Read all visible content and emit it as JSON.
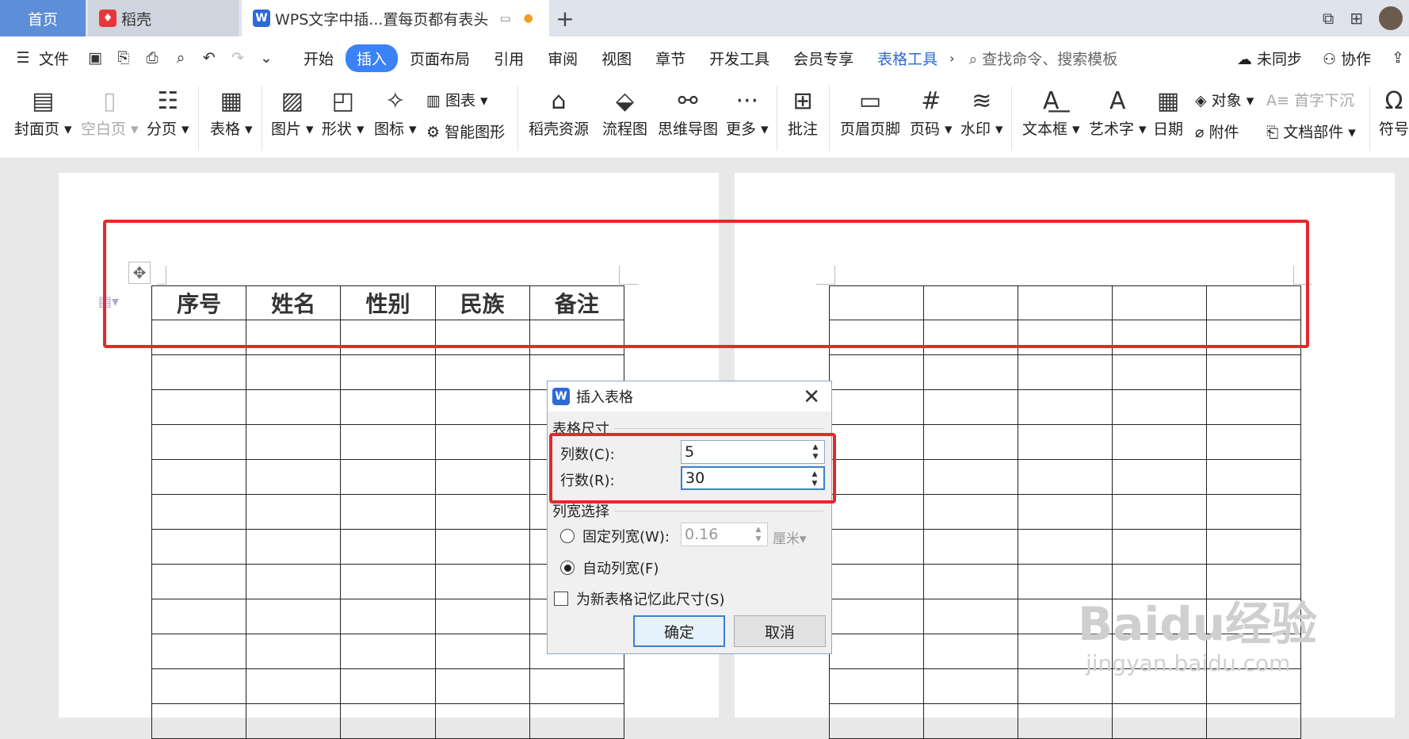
{
  "tabs": [
    {
      "label": "首页"
    },
    {
      "label": "稻壳",
      "icon": "W"
    },
    {
      "label": "WPS文字中插...置每页都有表头",
      "icon": "W"
    }
  ],
  "menu": {
    "file": "文件",
    "items": [
      "开始",
      "插入",
      "页面布局",
      "引用",
      "审阅",
      "视图",
      "章节",
      "开发工具",
      "会员专享",
      "表格工具"
    ],
    "active": "插入",
    "search_placeholder": "查找命令、搜索模板",
    "sync": "未同步",
    "collab": "协作"
  },
  "ribbon": {
    "cover": "封面页",
    "blank": "空白页",
    "pagebreak": "分页",
    "table": "表格",
    "image": "图片",
    "shape": "形状",
    "icon": "图标",
    "chart": "图表",
    "smart": "智能图形",
    "docer": "稻壳资源",
    "flow": "流程图",
    "mind": "思维导图",
    "more": "更多",
    "comment": "批注",
    "headerfooter": "页眉页脚",
    "pagenum": "页码",
    "watermark": "水印",
    "textbox": "文本框",
    "wordart": "艺术字",
    "date": "日期",
    "object": "对象",
    "attach": "附件",
    "dropcap": "首字下沉",
    "docpart": "文档部件",
    "symbol": "符号"
  },
  "table_headers": [
    "序号",
    "姓名",
    "性别",
    "民族",
    "备注"
  ],
  "dialog": {
    "title": "插入表格",
    "size_section": "表格尺寸",
    "cols_label": "列数(C):",
    "cols_value": "5",
    "rows_label": "行数(R):",
    "rows_value": "30",
    "width_section": "列宽选择",
    "fixed_label": "固定列宽(W):",
    "fixed_value": "0.16",
    "unit": "厘米",
    "auto_label": "自动列宽(F)",
    "remember_label": "为新表格记忆此尺寸(S)",
    "ok": "确定",
    "cancel": "取消"
  },
  "watermark": {
    "main": "Baidu经验",
    "sub": "jingyan.baidu.com"
  },
  "colors": {
    "accent": "#3b82f6",
    "highlight": "#e5282a"
  }
}
